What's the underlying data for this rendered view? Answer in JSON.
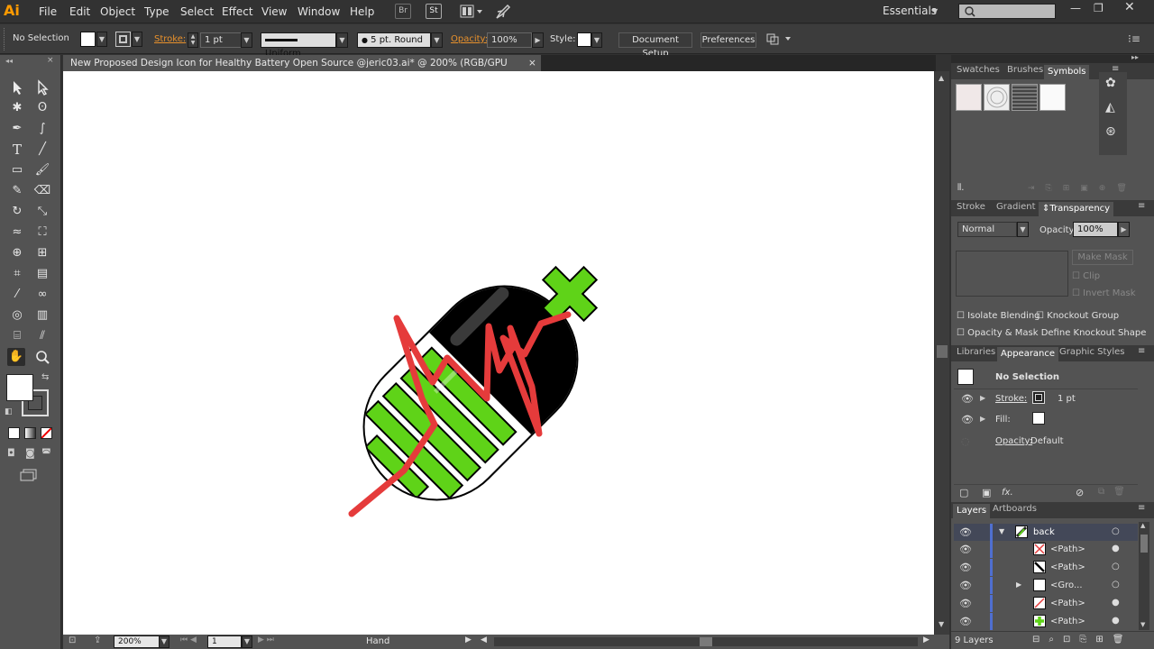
{
  "menubar": {
    "logo": "Ai",
    "items": [
      "File",
      "Edit",
      "Object",
      "Type",
      "Select",
      "Effect",
      "View",
      "Window",
      "Help"
    ],
    "bridge": "Br",
    "stock": "St",
    "workspace": "Essentials"
  },
  "control": {
    "selection": "No Selection",
    "stroke_label": "Stroke:",
    "stroke_weight": "1 pt",
    "stroke_profile": "Uniform",
    "brush": "5 pt. Round",
    "opacity_label": "Opacity:",
    "opacity": "100%",
    "style_label": "Style:",
    "doc_setup": "Document Setup",
    "preferences": "Preferences"
  },
  "document": {
    "tab_title": "New Proposed Design Icon for Healthy Battery Open Source @jeric03.ai* @ 200% (RGB/GPU Preview)",
    "close": "×"
  },
  "status": {
    "zoom": "200%",
    "artboard": "1",
    "tool": "Hand"
  },
  "symbols_panel": {
    "tabs": [
      "Swatches",
      "Brushes",
      "Symbols"
    ]
  },
  "transparency_panel": {
    "tabs": [
      "Stroke",
      "Gradient",
      "Transparency"
    ],
    "blend_mode": "Normal",
    "opacity_label": "Opacity:",
    "opacity": "100%",
    "make_mask": "Make Mask",
    "clip": "Clip",
    "invert_mask": "Invert Mask",
    "isolate": "Isolate Blending",
    "knockout": "Knockout Group",
    "define_knockout": "Opacity & Mask Define Knockout Shape"
  },
  "appearance_panel": {
    "tabs": [
      "Libraries",
      "Appearance",
      "Graphic Styles"
    ],
    "title": "No Selection",
    "stroke_label": "Stroke:",
    "stroke_value": "1 pt",
    "fill_label": "Fill:",
    "opacity_label": "Opacity:",
    "opacity_value": "Default",
    "fx": "fx."
  },
  "layers_panel": {
    "tabs": [
      "Layers",
      "Artboards"
    ],
    "layer": "back",
    "rows": [
      "<Path>",
      "<Path>",
      "<Gro...",
      "<Path>",
      "<Path>"
    ],
    "count": "9 Layers"
  },
  "colors": {
    "accent": "#e8912c",
    "green": "#5fd318",
    "red": "#e53b3b"
  }
}
